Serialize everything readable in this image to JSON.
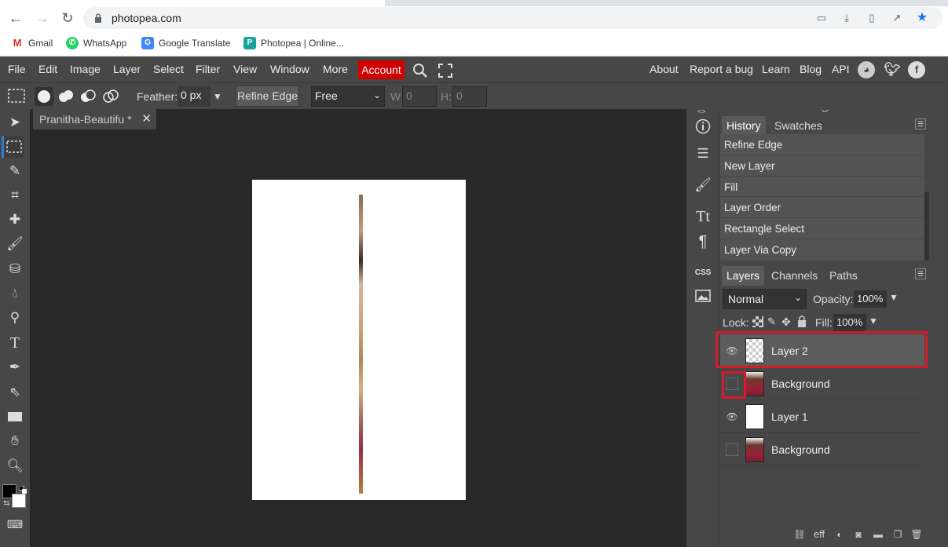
{
  "browser": {
    "url": "photopea.com",
    "bookmarks": [
      "Gmail",
      "WhatsApp",
      "Google Translate",
      "Photopea | Online..."
    ]
  },
  "menu": {
    "items": [
      "File",
      "Edit",
      "Image",
      "Layer",
      "Select",
      "Filter",
      "View",
      "Window",
      "More"
    ],
    "account": "Account",
    "right_items": [
      "About",
      "Report a bug",
      "Learn",
      "Blog",
      "API"
    ]
  },
  "options": {
    "feather_label": "Feather:",
    "feather_value": "0 px",
    "refine_edge": "Refine Edge",
    "style_value": "Free",
    "w_label": "W:",
    "w_value": "0",
    "h_label": "H:",
    "h_value": "0"
  },
  "document": {
    "tab_title": "Pranitha-Beautifu *"
  },
  "history_panel": {
    "tabs": [
      "History",
      "Swatches"
    ],
    "items": [
      "Refine Edge",
      "New Layer",
      "Fill",
      "Layer Order",
      "Rectangle Select",
      "Layer Via Copy"
    ]
  },
  "layers_panel": {
    "tabs": [
      "Layers",
      "Channels",
      "Paths"
    ],
    "blend_mode": "Normal",
    "opacity_label": "Opacity:",
    "opacity_value": "100%",
    "lock_label": "Lock:",
    "fill_label": "Fill:",
    "fill_value": "100%",
    "layers": [
      {
        "name": "Layer 2",
        "visible": true,
        "selected": true,
        "thumb": "transparent"
      },
      {
        "name": "Background",
        "visible": false,
        "selected": false,
        "thumb": "photo"
      },
      {
        "name": "Layer 1",
        "visible": true,
        "selected": false,
        "thumb": "white"
      },
      {
        "name": "Background",
        "visible": false,
        "selected": false,
        "thumb": "photo"
      }
    ],
    "footer_icons": [
      "link-icon",
      "effects-icon",
      "adjustment-icon",
      "mask-icon",
      "folder-icon",
      "new-layer-icon",
      "trash-icon"
    ]
  },
  "colors": {
    "accent": "#2f7dd0",
    "account_bg": "#d10000",
    "highlight": "#d51a2a"
  }
}
